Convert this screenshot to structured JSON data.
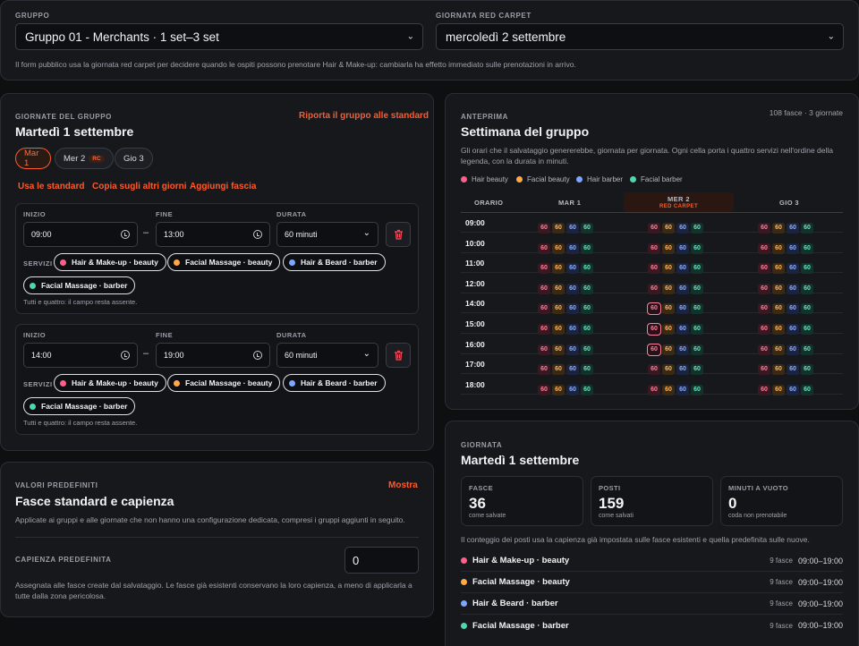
{
  "top": {
    "gruppo_label": "GRUPPO",
    "gruppo_value": "Gruppo 01 - Merchants · 1 set–3 set",
    "giornata_label": "GIORNATA RED CARPET",
    "giornata_value": "mercoledì 2 settembre",
    "note": "Il form pubblico usa la giornata red carpet per decidere quando le ospiti possono prenotare Hair & Make-up: cambiarla ha effetto immediato sulle prenotazioni in arrivo."
  },
  "giornate": {
    "label": "GIORNATE DEL GRUPPO",
    "title": "Martedì 1 settembre",
    "reset": "Riporta il gruppo alle standard",
    "days": [
      {
        "label": "Mar 1"
      },
      {
        "label": "Mer 2",
        "badge": "RC"
      },
      {
        "label": "Gio 3"
      }
    ],
    "actions": [
      "Usa le standard",
      "Copia sugli altri giorni",
      "Aggiungi fascia"
    ],
    "field_inizio": "INIZIO",
    "field_fine": "FINE",
    "field_durata": "DURATA",
    "field_servizi": "SERVIZI",
    "slots": [
      {
        "start": "09:00",
        "end": "13:00",
        "duration": "60 minuti",
        "hint": "Tutti e quattro: il campo resta assente."
      },
      {
        "start": "14:00",
        "end": "19:00",
        "duration": "60 minuti",
        "hint": "Tutti e quattro: il campo resta assente."
      }
    ],
    "dash": "–"
  },
  "services": [
    {
      "name": "Hair & Make-up · beauty",
      "legend": "Hair beauty",
      "color": "#ff5f8a"
    },
    {
      "name": "Facial Massage · beauty",
      "legend": "Facial beauty",
      "color": "#ffa94d"
    },
    {
      "name": "Hair & Beard · barber",
      "legend": "Hair barber",
      "color": "#7ea6ff"
    },
    {
      "name": "Facial Massage · barber",
      "legend": "Facial barber",
      "color": "#4fd6b0"
    }
  ],
  "anteprima": {
    "label": "ANTEPRIMA",
    "title": "Settimana del gruppo",
    "meta": "108 fasce · 3 giornate",
    "desc": "Gli orari che il salvataggio genererebbe, giornata per giornata. Ogni cella porta i quattro servizi nell'ordine della legenda, con la durata in minuti.",
    "col_orario": "ORARIO",
    "cols": [
      {
        "label": "MAR 1"
      },
      {
        "label": "MER 2",
        "sub": "RED CARPET"
      },
      {
        "label": "GIO 3"
      }
    ],
    "hours": [
      "09:00",
      "10:00",
      "11:00",
      "12:00",
      "14:00",
      "15:00",
      "16:00",
      "17:00",
      "18:00"
    ],
    "cell_value": "60",
    "highlight_rows": [
      4,
      5,
      6
    ]
  },
  "predefiniti": {
    "label": "VALORI PREDEFINITI",
    "title": "Fasce standard e capienza",
    "toggle": "Mostra",
    "desc": "Applicate ai gruppi e alle giornate che non hanno una configurazione dedicata, compresi i gruppi aggiunti in seguito.",
    "cap_label": "CAPIENZA PREDEFINITA",
    "cap_value": "0",
    "cap_desc": "Assegnata alle fasce create dal salvataggio. Le fasce già esistenti conservano la loro capienza, a meno di applicarla a tutte dalla zona pericolosa."
  },
  "giornata": {
    "label": "GIORNATA",
    "title": "Martedì 1 settembre",
    "stats": [
      {
        "label": "FASCE",
        "value": "36",
        "sub": "come salvate"
      },
      {
        "label": "POSTI",
        "value": "159",
        "sub": "come salvati"
      },
      {
        "label": "MINUTI A VUOTO",
        "value": "0",
        "sub": "coda non prenotabile"
      }
    ],
    "desc": "Il conteggio dei posti usa la capienza già impostata sulle fasce esistenti e quella predefinita sulle nuove.",
    "rows": [
      {
        "count": "9 fasce",
        "hours": "09:00–19:00"
      },
      {
        "count": "9 fasce",
        "hours": "09:00–19:00"
      },
      {
        "count": "9 fasce",
        "hours": "09:00–19:00"
      },
      {
        "count": "9 fasce",
        "hours": "09:00–19:00"
      }
    ]
  }
}
